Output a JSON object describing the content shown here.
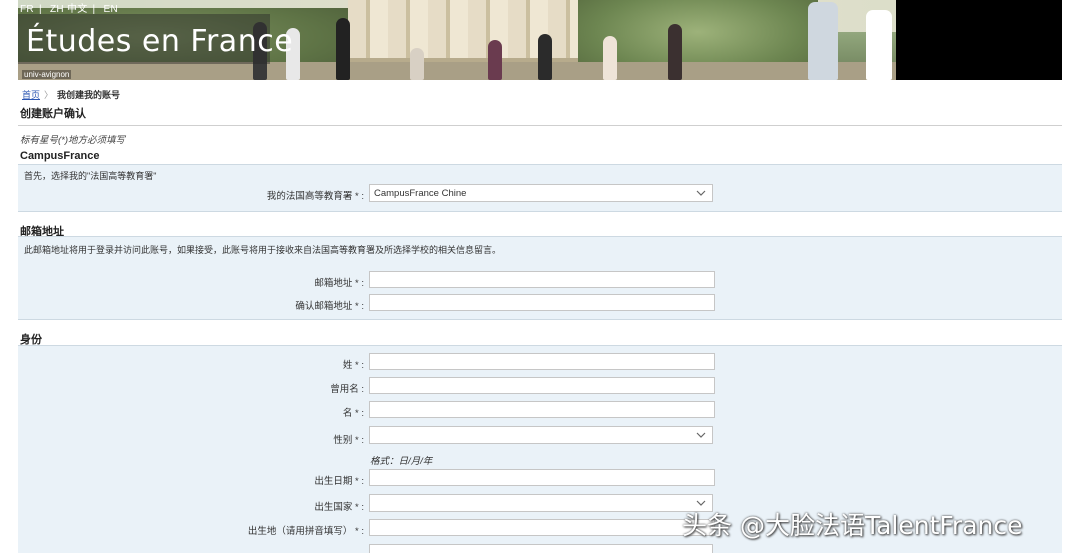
{
  "header": {
    "languages": [
      "FR",
      "ZH 中文",
      "EN"
    ],
    "site_title": "Études en France",
    "university_caption": "univ-avignon"
  },
  "breadcrumb": {
    "home": "首页",
    "current": "我创建我的账号"
  },
  "page_title": "创建账户确认",
  "required_note": "标有星号(*)地方必须填写",
  "campus_section": {
    "heading": "CampusFrance",
    "intro": "首先，选择我的\"法国高等教育署\"",
    "agency_label": "我的法国高等教育署 * :",
    "agency_value": "CampusFrance Chine"
  },
  "email_section": {
    "heading": "邮箱地址",
    "intro": "此邮箱地址将用于登录并访问此账号，如果接受，此账号将用于接收来自法国高等教育署及所选择学校的相关信息留言。",
    "email_label": "邮箱地址 * :",
    "confirm_label": "确认邮箱地址 * :"
  },
  "identity_section": {
    "heading": "身份",
    "surname_label": "姓 * :",
    "former_name_label": "曾用名 :",
    "given_name_label": "名 * :",
    "gender_label": "性别 * :",
    "date_hint": "格式：日/月/年",
    "birth_date_label": "出生日期 * :",
    "birth_country_label": "出生国家 * :",
    "birth_place_label": "出生地（请用拼音填写） * :"
  },
  "watermark": "头条 @大脸法语TalentFrance"
}
